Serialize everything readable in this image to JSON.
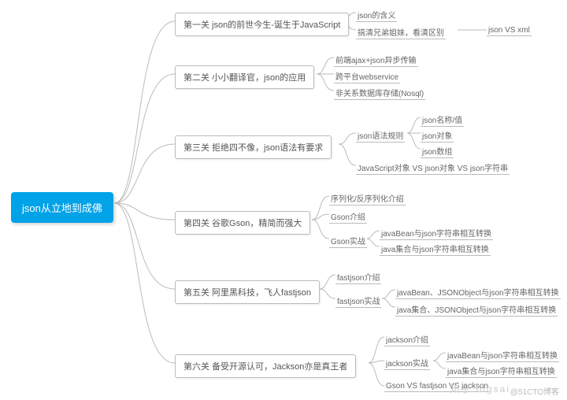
{
  "root": {
    "label": "json从立地到成佛"
  },
  "l1": {
    "label": "第一关 json的前世今生-诞生于JavaScript"
  },
  "l1_1": {
    "label": "json的含义"
  },
  "l1_2": {
    "label": "搞清兄弟姐妹，看清区别"
  },
  "l1_2b": {
    "label": "json VS xml"
  },
  "l2": {
    "label": "第二关 小小翻译官，json的应用"
  },
  "l2_1": {
    "label": "前端ajax+json异步传输"
  },
  "l2_2": {
    "label": "跨平台webservice"
  },
  "l2_3": {
    "label": "非关系数据库存储(Nosql)"
  },
  "l3": {
    "label": "第三关 拒绝四不像，json语法有要求"
  },
  "l3_1": {
    "label": "json语法规则"
  },
  "l3_1a": {
    "label": "json名称/值"
  },
  "l3_1b": {
    "label": "json对象"
  },
  "l3_1c": {
    "label": "json数组"
  },
  "l3_2": {
    "label": "JavaScript对象 VS json对象 VS json字符串"
  },
  "l4": {
    "label": "第四关 谷歌Gson，精简而强大"
  },
  "l4_1": {
    "label": "序列化/反序列化介绍"
  },
  "l4_2": {
    "label": "Gson介绍"
  },
  "l4_3": {
    "label": "Gson实战"
  },
  "l4_3a": {
    "label": "javaBean与json字符串相互转换"
  },
  "l4_3b": {
    "label": "java集合与json字符串相互转换"
  },
  "l5": {
    "label": "第五关 阿里黑科技，飞人fastjson"
  },
  "l5_1": {
    "label": "fastjson介绍"
  },
  "l5_2": {
    "label": "fastjson实战"
  },
  "l5_2a": {
    "label": "javaBean、JSONObject与json字符串相互转换"
  },
  "l5_2b": {
    "label": "java集合、JSONObject与json字符串相互转换"
  },
  "l6": {
    "label": "第六关 备受开源认可，Jackson亦是真王者"
  },
  "l6_1": {
    "label": "jackson介绍"
  },
  "l6_2": {
    "label": "jackson实战"
  },
  "l6_2a": {
    "label": "javaBean与json字符串相互转换"
  },
  "l6_2b": {
    "label": "java集合与json字符串相互转换"
  },
  "l6_3": {
    "label": "Gson VS fastjson VS jackson"
  },
  "watermark": {
    "text": "@51CTO博客"
  },
  "watermark2": {
    "text": "知乎 bigsai"
  }
}
